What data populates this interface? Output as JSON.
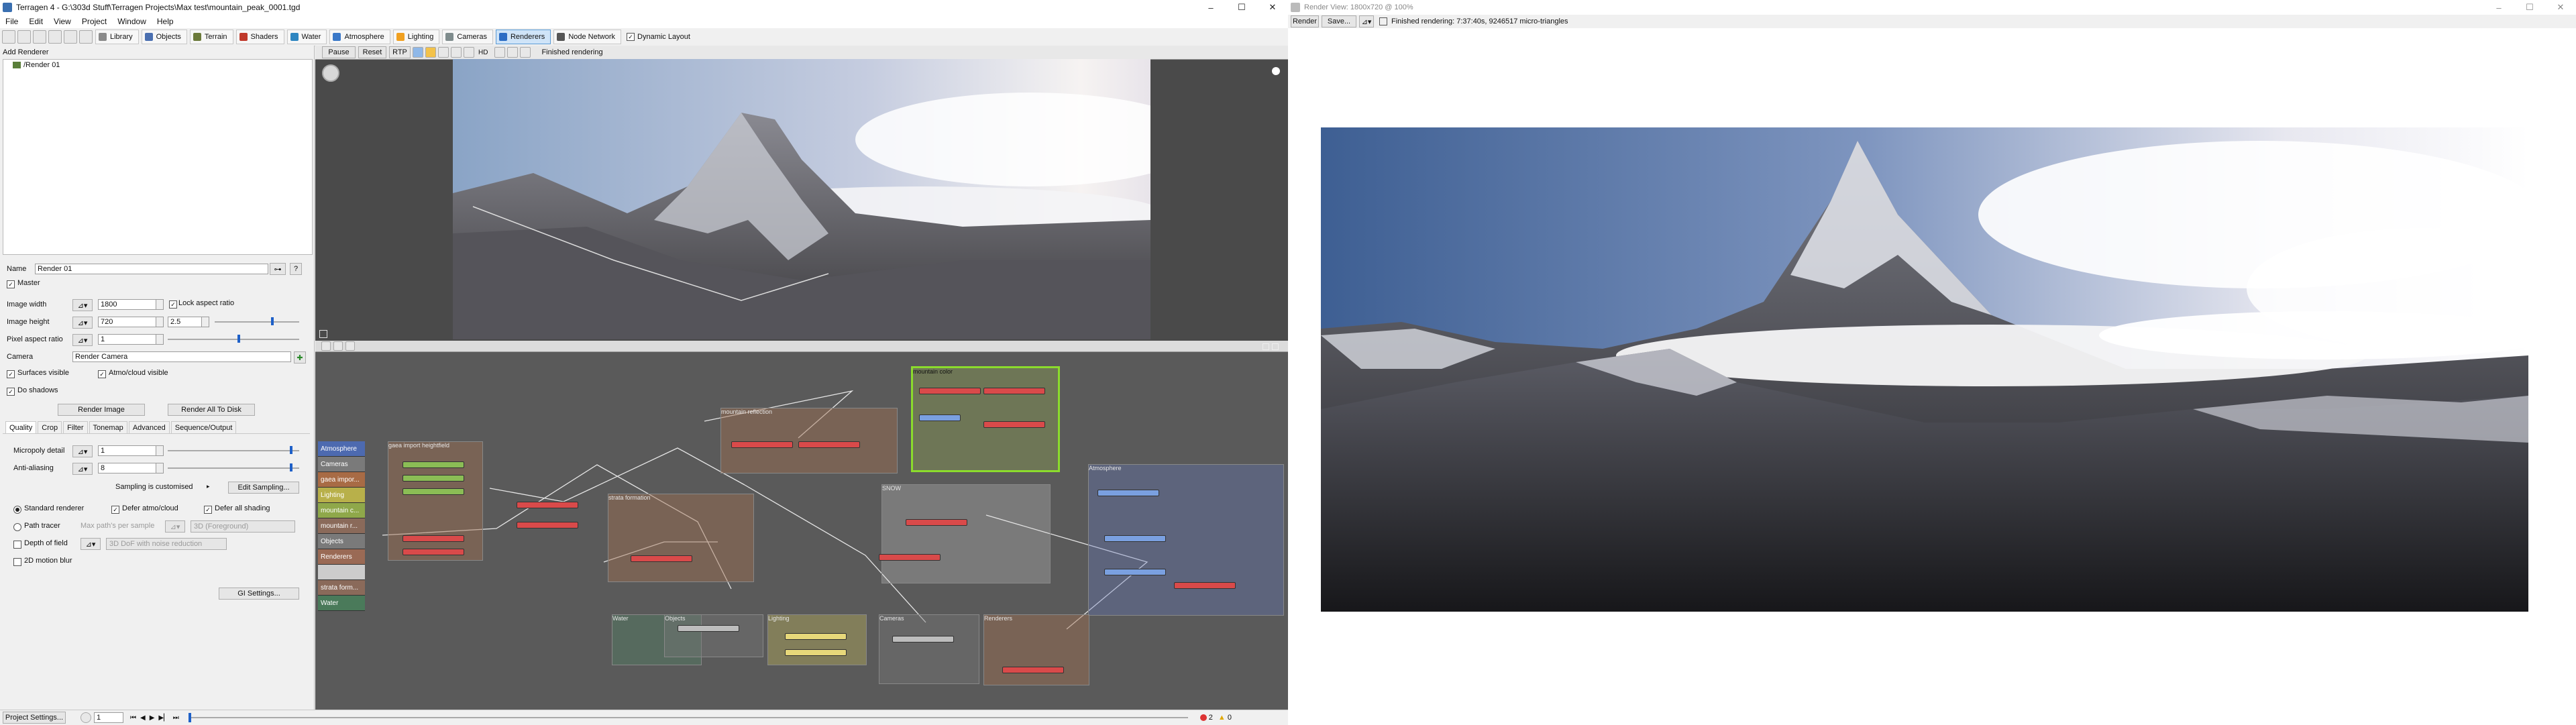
{
  "main_window": {
    "title": "Terragen 4 - G:\\303d Stuff\\Terragen Projects\\Max test\\mountain_peak_0001.tgd",
    "controls": {
      "minimize": "–",
      "maximize": "☐",
      "close": "✕"
    }
  },
  "menu": [
    "File",
    "Edit",
    "View",
    "Project",
    "Window",
    "Help"
  ],
  "toolbar": {
    "sections": [
      {
        "label": "Library",
        "color": "#8a8a8a"
      },
      {
        "label": "Objects",
        "color": "#4a6fb0"
      },
      {
        "label": "Terrain",
        "color": "#6b7a3a"
      },
      {
        "label": "Shaders",
        "color": "#c0392b"
      },
      {
        "label": "Water",
        "color": "#2e86c1"
      },
      {
        "label": "Atmosphere",
        "color": "#3a78c8"
      },
      {
        "label": "Lighting",
        "color": "#f0a020"
      },
      {
        "label": "Cameras",
        "color": "#7f8c8d"
      },
      {
        "label": "Renderers",
        "color": "#2b6cc4",
        "active": true
      },
      {
        "label": "Node Network",
        "color": "#555555"
      }
    ],
    "dynamic_layout_label": "Dynamic Layout",
    "dynamic_layout_checked": true
  },
  "left_panel": {
    "add_renderer_label": "Add Renderer",
    "renderers": [
      "/Render 01"
    ],
    "name_label": "Name",
    "name_value": "Render 01",
    "help_label": "?",
    "master_label": "Master",
    "image_width_label": "Image width",
    "image_width_value": "1800",
    "lock_aspect_label": "Lock aspect ratio",
    "image_height_label": "Image height",
    "image_height_value": "720",
    "aspect_value": "2.5",
    "pixel_aspect_label": "Pixel aspect ratio",
    "pixel_aspect_value": "1",
    "camera_label": "Camera",
    "camera_value": "Render Camera",
    "surfaces_visible_label": "Surfaces visible",
    "atmo_visible_label": "Atmo/cloud visible",
    "do_shadows_label": "Do shadows",
    "render_image_label": "Render Image",
    "render_all_label": "Render All To Disk",
    "tabs": [
      "Quality",
      "Crop",
      "Filter",
      "Tonemap",
      "Advanced",
      "Sequence/Output"
    ],
    "micropoly_label": "Micropoly detail",
    "micropoly_value": "1",
    "antialiasing_label": "Anti-aliasing",
    "antialiasing_value": "8",
    "sampling_text": "Sampling is customised",
    "edit_sampling_label": "Edit Sampling...",
    "standard_renderer_label": "Standard renderer",
    "defer_atmo_label": "Defer atmo/cloud",
    "defer_shading_label": "Defer all shading",
    "path_tracer_label": "Path tracer",
    "max_paths_label": "Max path's per sample",
    "foreground_value": "3D (Foreground)",
    "depth_of_field_label": "Depth of field",
    "dof_value": "3D DoF with noise reduction",
    "motion_blur_label": "2D motion blur",
    "gi_settings_label": "GI Settings..."
  },
  "viewport": {
    "pause_label": "Pause",
    "reset_label": "Reset",
    "rtp_label": "RTP",
    "hd_label": "HD",
    "status": "Finished rendering"
  },
  "node_network": {
    "sidebar": [
      {
        "label": "Atmosphere",
        "color": "#4d6ab0"
      },
      {
        "label": "Cameras",
        "color": "#7a7a7a"
      },
      {
        "label": "gaea impor...",
        "color": "#a86b45"
      },
      {
        "label": "Lighting",
        "color": "#b8b04a"
      },
      {
        "label": "mountain c...",
        "color": "#8fa84a"
      },
      {
        "label": "mountain r...",
        "color": "#8a6a5a"
      },
      {
        "label": "Objects",
        "color": "#7a7a7a"
      },
      {
        "label": "Renderers",
        "color": "#9a6a55"
      },
      {
        "label": "",
        "color": "#cccccc"
      },
      {
        "label": "strata form...",
        "color": "#8a6a5a"
      },
      {
        "label": "Water",
        "color": "#4a7a5a"
      }
    ],
    "groups": {
      "gaea": "gaea import heightfield",
      "strata": "strata formation",
      "reflection": "mountain reflection",
      "color": "mountain color",
      "snow": "SNOW",
      "atmosphere": "Atmosphere",
      "water": "Water",
      "objects": "Objects",
      "lighting": "Lighting",
      "cameras": "Cameras",
      "renderers": "Renderers"
    }
  },
  "statusbar": {
    "project_settings_label": "Project Settings...",
    "frame_value": "1",
    "errors": "2",
    "warnings": "0"
  },
  "render_window": {
    "title": "Render View: 1800x720 @ 100%",
    "render_label": "Render",
    "save_label": "Save...",
    "status": "Finished rendering: 7:37:40s, 9246517 micro-triangles",
    "controls": {
      "minimize": "–",
      "maximize": "☐",
      "close": "✕"
    }
  }
}
